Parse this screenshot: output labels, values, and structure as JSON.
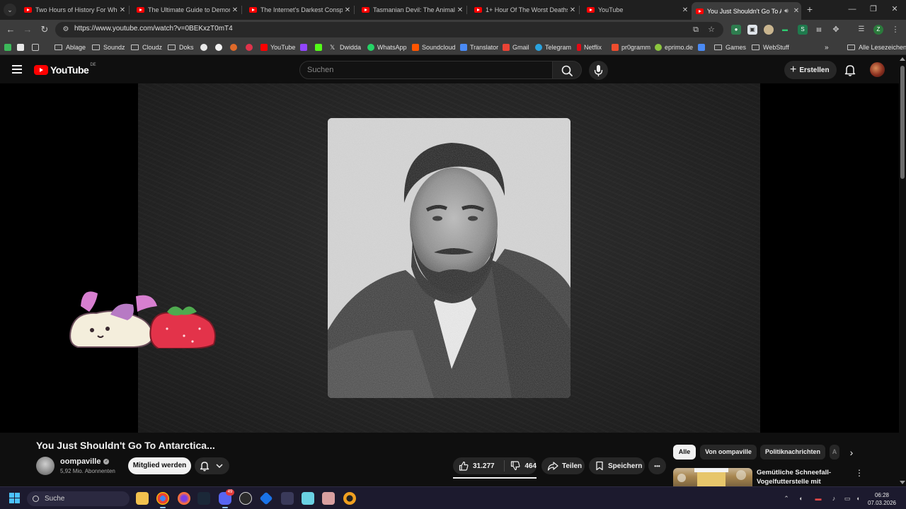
{
  "browser": {
    "tabs": [
      {
        "title": "Two Hours of History For When",
        "active": false
      },
      {
        "title": "The Ultimate Guide to Demons",
        "active": false
      },
      {
        "title": "The Internet's Darkest Conspira",
        "active": false
      },
      {
        "title": "Tasmanian Devil: The Animal Th",
        "active": false
      },
      {
        "title": "1+ Hour Of The Worst Deaths I",
        "active": false
      },
      {
        "title": "YouTube",
        "active": false
      },
      {
        "title": "You Just Shouldn't Go To An",
        "active": true
      }
    ],
    "url": "https://www.youtube.com/watch?v=0BEKxzT0mT4",
    "bookmarks": [
      {
        "label": "Ablage",
        "kind": "folder"
      },
      {
        "label": "Soundz",
        "kind": "folder"
      },
      {
        "label": "Cloudz",
        "kind": "folder"
      },
      {
        "label": "Doks",
        "kind": "folder"
      },
      {
        "label": "YouTube",
        "kind": "site",
        "color": "#ff0000"
      },
      {
        "label": "Dwidda",
        "kind": "site",
        "color": "#e3e3e3"
      },
      {
        "label": "WhatsApp",
        "kind": "site",
        "color": "#25d366"
      },
      {
        "label": "Soundcloud",
        "kind": "site",
        "color": "#ff5500"
      },
      {
        "label": "Translator",
        "kind": "site",
        "color": "#4a8af4"
      },
      {
        "label": "Gmail",
        "kind": "site",
        "color": "#ea4335"
      },
      {
        "label": "Telegram",
        "kind": "site",
        "color": "#2aa3df"
      },
      {
        "label": "Netflix",
        "kind": "site",
        "color": "#e50914"
      },
      {
        "label": "pr0gramm",
        "kind": "site",
        "color": "#ee4d2e"
      },
      {
        "label": "eprimo.de",
        "kind": "site",
        "color": "#8cc63f"
      },
      {
        "label": "Games",
        "kind": "folder"
      },
      {
        "label": "WebStuff",
        "kind": "folder"
      }
    ],
    "bookmarks_more": "»",
    "all_bookmarks": "Alle Lesezeichen"
  },
  "youtube": {
    "logo_text": "YouTube",
    "country_code": "DE",
    "search_placeholder": "Suchen",
    "create_label": "Erstellen",
    "video": {
      "title": "You Just Shouldn't Go To Antarctica...",
      "channel": "oompaville",
      "subscribers": "5,92 Mio. Abonnenten",
      "join_label": "Mitglied werden",
      "likes": "31.277",
      "dislikes": "464",
      "share_label": "Teilen",
      "save_label": "Speichern",
      "more_label": "•••"
    },
    "chips": [
      {
        "label": "Alle",
        "selected": true
      },
      {
        "label": "Von oompaville",
        "selected": false
      },
      {
        "label": "Politiknachrichten",
        "selected": false
      },
      {
        "label": "A",
        "selected": false
      }
    ],
    "recommendation": {
      "title": "Gemütliche Schneefall-Vogelfutterstelle mit Kardinäle..."
    }
  },
  "taskbar": {
    "search_label": "Suche",
    "badge_count": "49",
    "time": "06:28",
    "date": "07.03.2026"
  }
}
